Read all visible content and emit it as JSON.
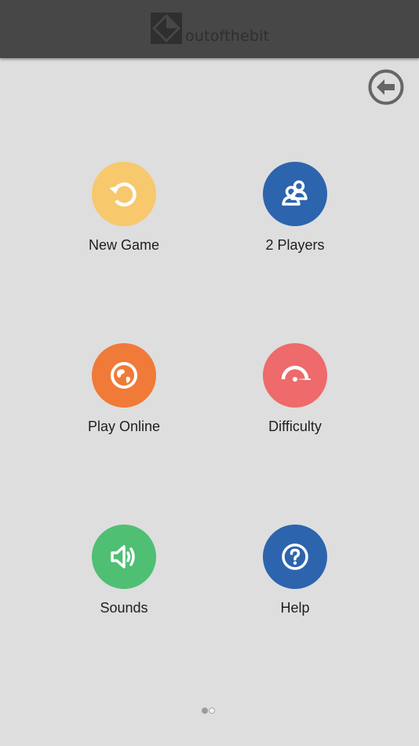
{
  "header": {
    "logo_text": "outofthebit",
    "logo_icon": "outofthebit-logo-icon",
    "background_color": "#474747"
  },
  "back_button": {
    "icon": "arrow-left-circle-icon",
    "color": "#666666"
  },
  "menu": {
    "items": [
      {
        "label": "New Game",
        "icon": "restart-icon",
        "color": "#f7c86c"
      },
      {
        "label": "2 Players",
        "icon": "two-players-icon",
        "color": "#2d64ae"
      },
      {
        "label": "Play Online",
        "icon": "globe-icon",
        "color": "#f07a37"
      },
      {
        "label": "Difficulty",
        "icon": "gauge-icon",
        "color": "#ee6a6b"
      },
      {
        "label": "Sounds",
        "icon": "speaker-icon",
        "color": "#4fbf74"
      },
      {
        "label": "Help",
        "icon": "question-icon",
        "color": "#2d64ae"
      }
    ]
  },
  "pager": {
    "pages": 2,
    "current_page": 1
  },
  "background_color": "#dedede"
}
